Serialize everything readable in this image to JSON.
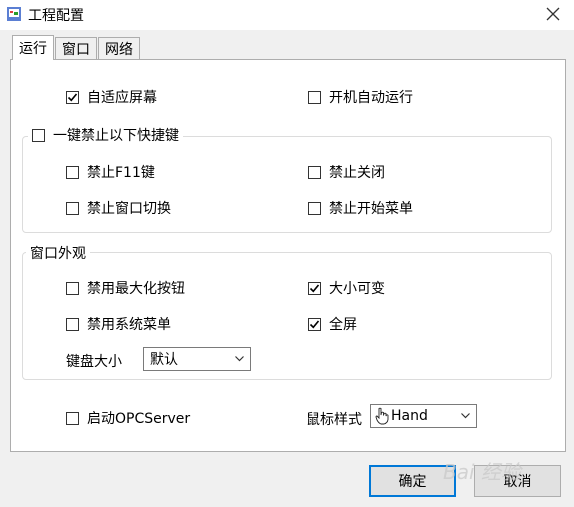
{
  "window": {
    "title": "工程配置"
  },
  "tabs": [
    {
      "label": "运行"
    },
    {
      "label": "窗口"
    },
    {
      "label": "网络"
    }
  ],
  "run": {
    "adaptive_screen": {
      "label": "自适应屏幕",
      "checked": true
    },
    "auto_run_on_boot": {
      "label": "开机自动运行",
      "checked": false
    },
    "disable_shortcuts": {
      "label": "一键禁止以下快捷键",
      "checked": false,
      "items": {
        "f11": {
          "label": "禁止F11键",
          "checked": false
        },
        "close": {
          "label": "禁止关闭",
          "checked": false
        },
        "window_switch": {
          "label": "禁止窗口切换",
          "checked": false
        },
        "start_menu": {
          "label": "禁止开始菜单",
          "checked": false
        }
      }
    },
    "appearance": {
      "label": "窗口外观",
      "disable_max_button": {
        "label": "禁用最大化按钮",
        "checked": false
      },
      "resizable": {
        "label": "大小可变",
        "checked": true
      },
      "disable_system_menu": {
        "label": "禁用系统菜单",
        "checked": false
      },
      "fullscreen": {
        "label": "全屏",
        "checked": true
      },
      "keyboard_size": {
        "label": "键盘大小",
        "value": "默认"
      }
    },
    "opc_server": {
      "label": "启动OPCServer",
      "checked": false
    },
    "cursor_style": {
      "label": "鼠标样式",
      "value": "Hand"
    }
  },
  "footer": {
    "ok_label": "确定",
    "cancel_label": "取消"
  },
  "watermark": {
    "text": "Bai 经验"
  }
}
